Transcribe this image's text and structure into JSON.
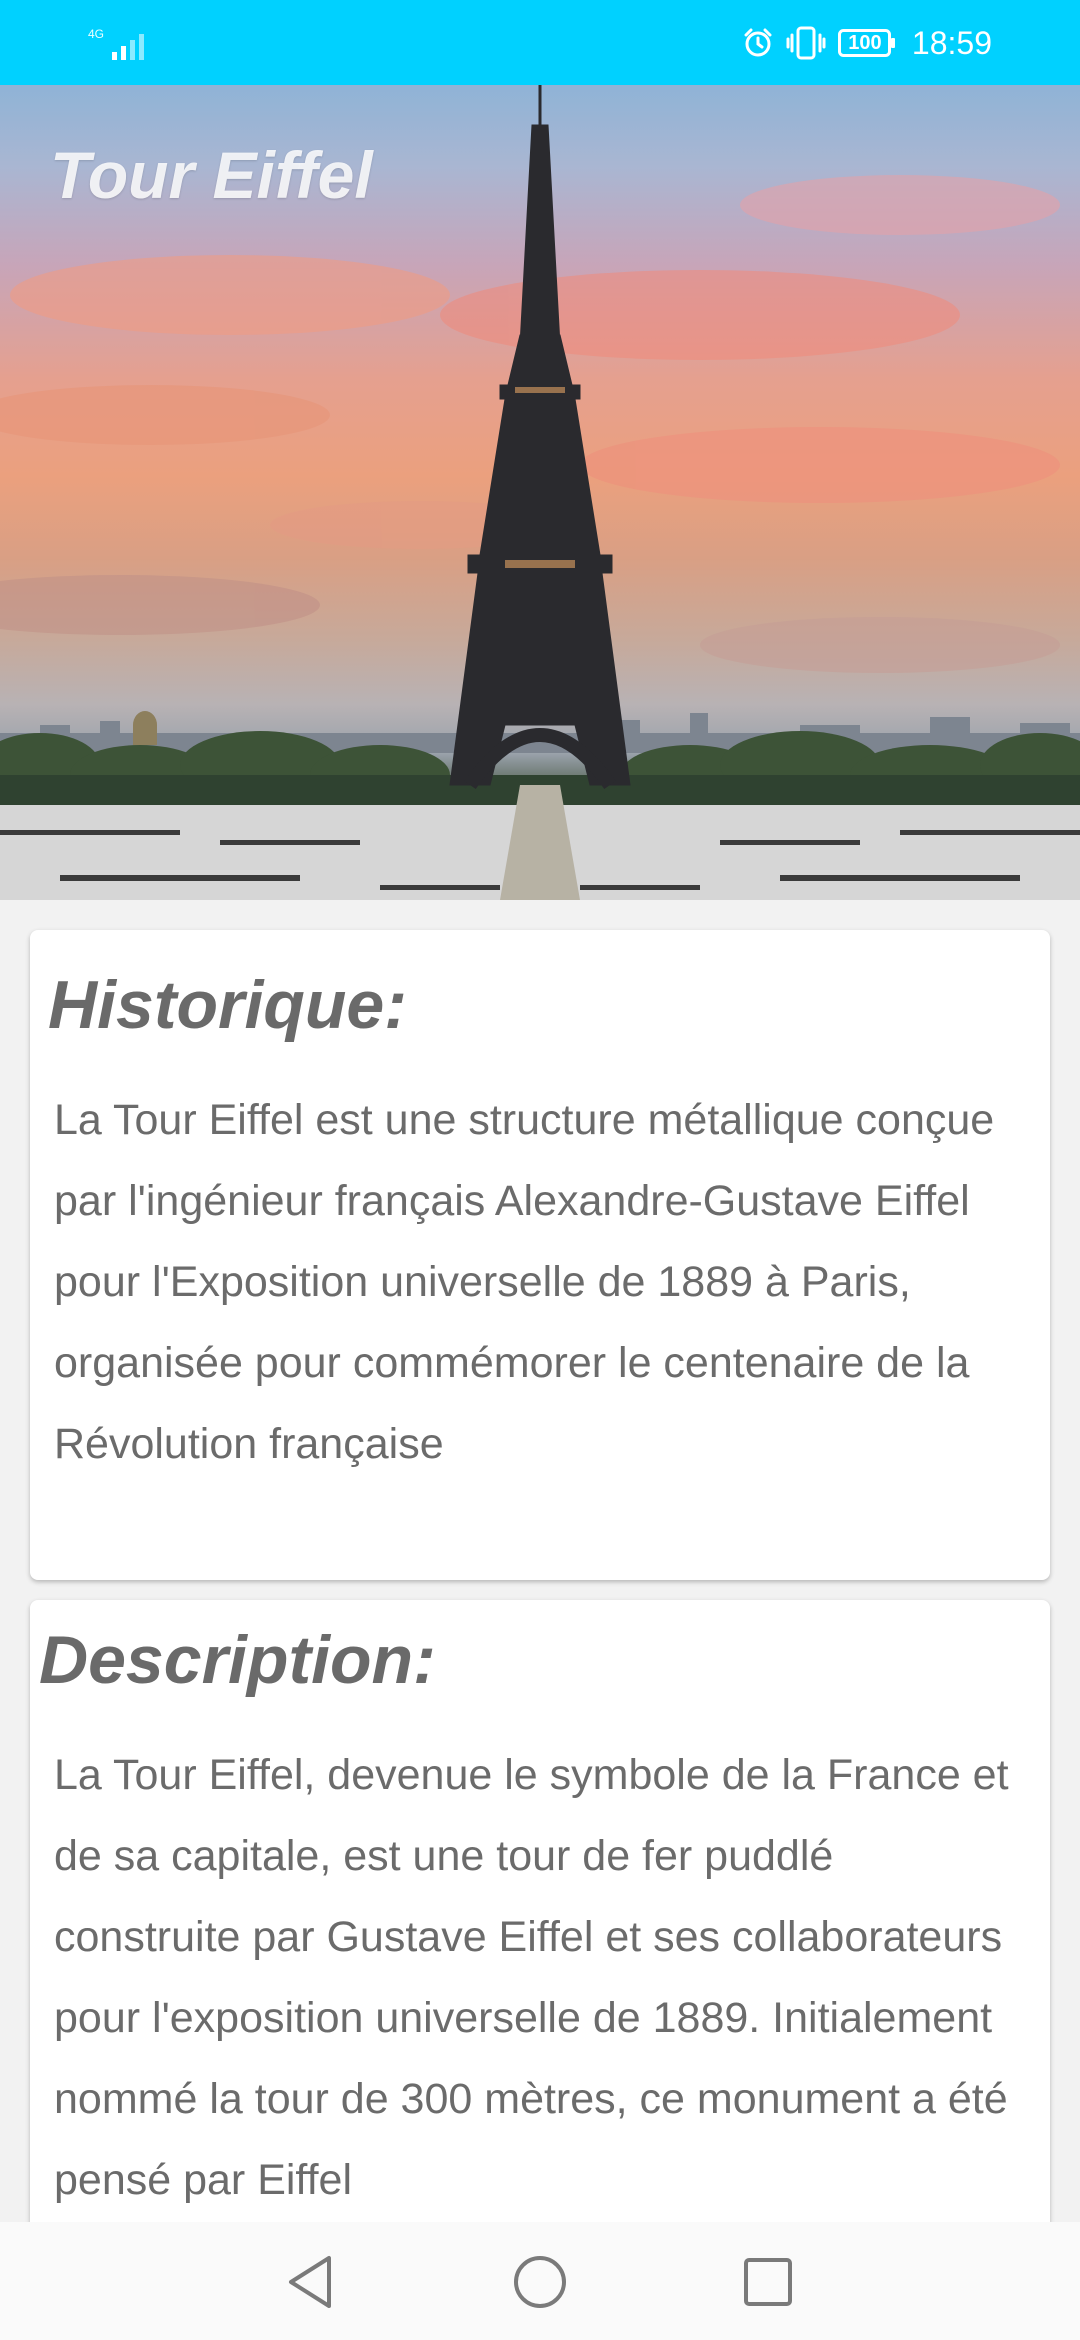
{
  "status_bar": {
    "network_type": "4G",
    "time": "18:59",
    "battery_level": "100",
    "icons": [
      "signal-icon",
      "alarm-icon",
      "vibrate-icon",
      "battery-icon"
    ],
    "background_color": "#00d1ff"
  },
  "hero": {
    "title": "Tour Eiffel",
    "image_subject": "eiffel-tower-sunset-photo"
  },
  "sections": [
    {
      "title": "Historique:",
      "text": "La Tour Eiffel est une structure métallique conçue par l'ingénieur français Alexandre-Gustave Eiffel pour l'Exposition universelle de 1889 à Paris, organisée pour commémorer le centenaire de la Révolution française"
    },
    {
      "title": "Description:",
      "text": "La Tour Eiffel, devenue le symbole de la France et de sa capitale, est une tour de fer puddlé construite par Gustave Eiffel et ses collaborateurs pour l'exposition universelle de 1889. Initialement nommé la tour de 300 mètres, ce monument a été pensé par Eiffel"
    }
  ],
  "nav_bar": {
    "buttons": [
      "back-icon",
      "home-icon",
      "recent-apps-icon"
    ]
  }
}
